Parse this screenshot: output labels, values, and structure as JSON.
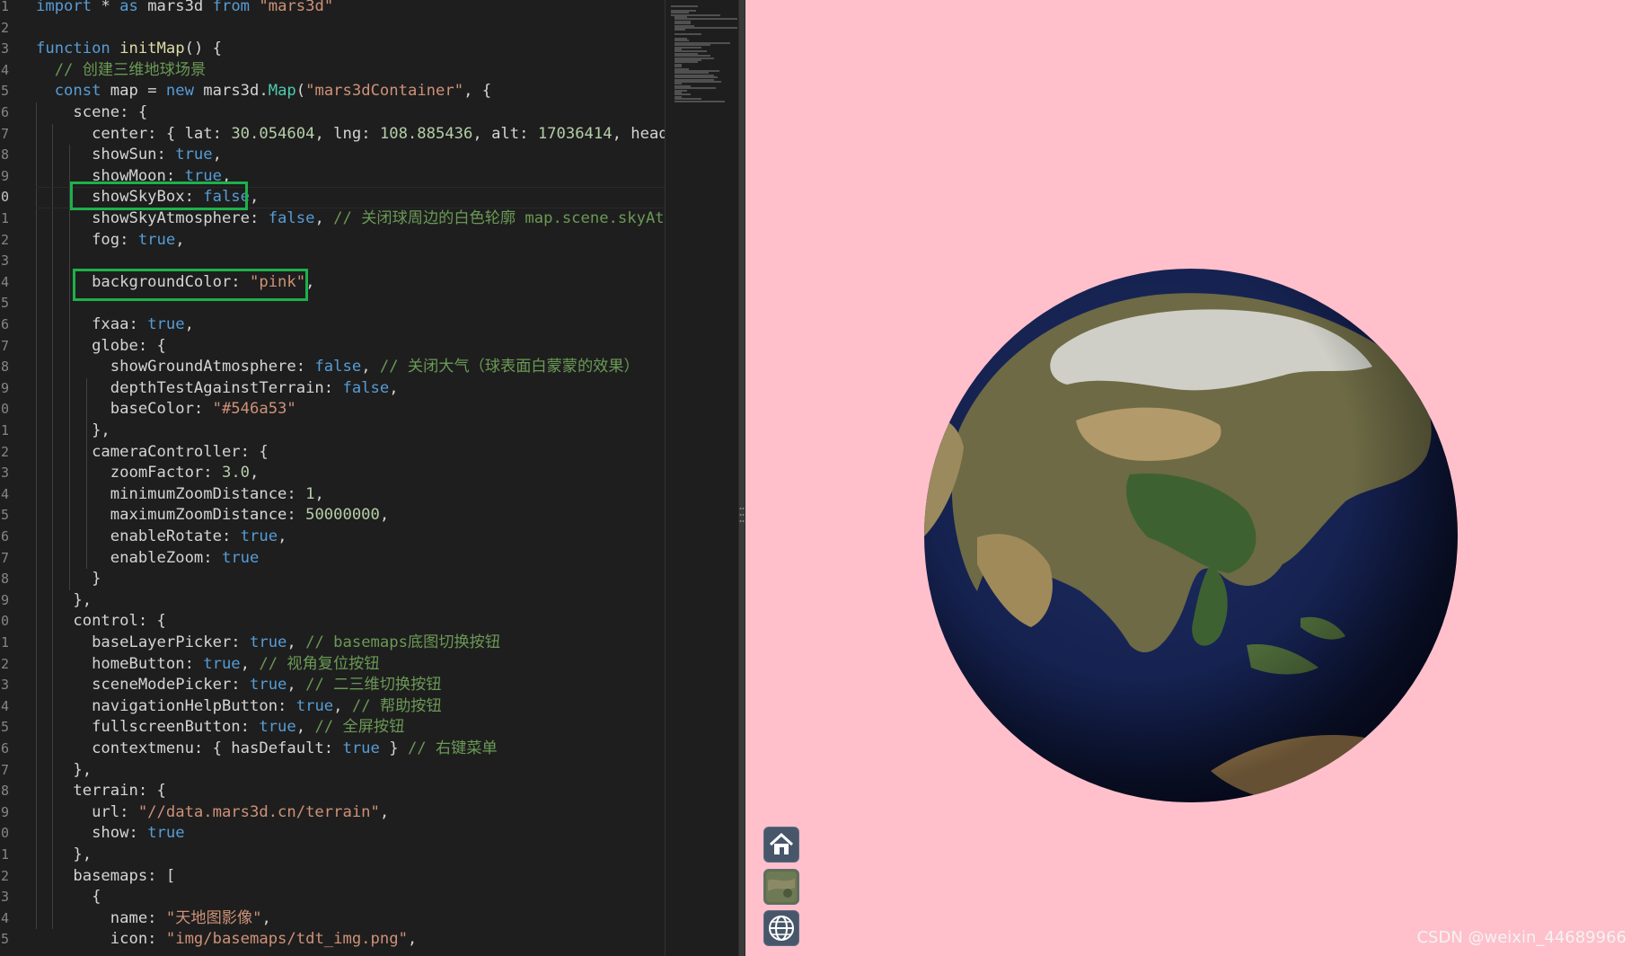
{
  "editor": {
    "lines": [
      {
        "n": "1",
        "tokens": [
          [
            "k",
            "import"
          ],
          [
            "x",
            " * "
          ],
          [
            "k",
            "as"
          ],
          [
            "x",
            " mars3d "
          ],
          [
            "k",
            "from"
          ],
          [
            "x",
            " "
          ],
          [
            "s",
            "\"mars3d\""
          ]
        ]
      },
      {
        "n": "2",
        "tokens": []
      },
      {
        "n": "3",
        "tokens": [
          [
            "k",
            "function"
          ],
          [
            "x",
            " "
          ],
          [
            "f",
            "initMap"
          ],
          [
            "x",
            "() {"
          ]
        ]
      },
      {
        "n": "4",
        "tokens": [
          [
            "x",
            "  "
          ],
          [
            "c",
            "// 创建三维地球场景"
          ]
        ]
      },
      {
        "n": "5",
        "tokens": [
          [
            "x",
            "  "
          ],
          [
            "k",
            "const"
          ],
          [
            "x",
            " map = "
          ],
          [
            "k",
            "new"
          ],
          [
            "x",
            " mars3d."
          ],
          [
            "t",
            "Map"
          ],
          [
            "x",
            "("
          ],
          [
            "s",
            "\"mars3dContainer\""
          ],
          [
            "x",
            ", {"
          ]
        ]
      },
      {
        "n": "6",
        "tokens": [
          [
            "x",
            "    scene: {"
          ]
        ]
      },
      {
        "n": "7",
        "tokens": [
          [
            "x",
            "      center: { lat: "
          ],
          [
            "n",
            "30.054604"
          ],
          [
            "x",
            ", lng: "
          ],
          [
            "n",
            "108.885436"
          ],
          [
            "x",
            ", alt: "
          ],
          [
            "n",
            "17036414"
          ],
          [
            "x",
            ", heading:"
          ]
        ]
      },
      {
        "n": "8",
        "tokens": [
          [
            "x",
            "      showSun: "
          ],
          [
            "k",
            "true"
          ],
          [
            "x",
            ","
          ]
        ]
      },
      {
        "n": "9",
        "tokens": [
          [
            "x",
            "      showMoon: "
          ],
          [
            "k",
            "true"
          ],
          [
            "x",
            ","
          ]
        ]
      },
      {
        "n": "0",
        "tokens": [
          [
            "x",
            "      showSkyBox: "
          ],
          [
            "k",
            "false"
          ],
          [
            "x",
            ","
          ]
        ]
      },
      {
        "n": "1",
        "tokens": [
          [
            "x",
            "      showSkyAtmosphere: "
          ],
          [
            "k",
            "false"
          ],
          [
            "x",
            ", "
          ],
          [
            "c",
            "// 关闭球周边的白色轮廓 map.scene.skyAtmos"
          ]
        ]
      },
      {
        "n": "2",
        "tokens": [
          [
            "x",
            "      fog: "
          ],
          [
            "k",
            "true"
          ],
          [
            "x",
            ","
          ]
        ]
      },
      {
        "n": "3",
        "tokens": []
      },
      {
        "n": "4",
        "tokens": [
          [
            "x",
            "      backgroundColor: "
          ],
          [
            "s",
            "\"pink\""
          ],
          [
            "x",
            ","
          ]
        ]
      },
      {
        "n": "5",
        "tokens": []
      },
      {
        "n": "6",
        "tokens": [
          [
            "x",
            "      fxaa: "
          ],
          [
            "k",
            "true"
          ],
          [
            "x",
            ","
          ]
        ]
      },
      {
        "n": "7",
        "tokens": [
          [
            "x",
            "      globe: {"
          ]
        ]
      },
      {
        "n": "8",
        "tokens": [
          [
            "x",
            "        showGroundAtmosphere: "
          ],
          [
            "k",
            "false"
          ],
          [
            "x",
            ", "
          ],
          [
            "c",
            "// 关闭大气（球表面白蒙蒙的效果）"
          ]
        ]
      },
      {
        "n": "9",
        "tokens": [
          [
            "x",
            "        depthTestAgainstTerrain: "
          ],
          [
            "k",
            "false"
          ],
          [
            "x",
            ","
          ]
        ]
      },
      {
        "n": "0",
        "tokens": [
          [
            "x",
            "        baseColor: "
          ],
          [
            "s",
            "\"#546a53\""
          ]
        ]
      },
      {
        "n": "1",
        "tokens": [
          [
            "x",
            "      },"
          ]
        ]
      },
      {
        "n": "2",
        "tokens": [
          [
            "x",
            "      cameraController: {"
          ]
        ]
      },
      {
        "n": "3",
        "tokens": [
          [
            "x",
            "        zoomFactor: "
          ],
          [
            "n",
            "3.0"
          ],
          [
            "x",
            ","
          ]
        ]
      },
      {
        "n": "4",
        "tokens": [
          [
            "x",
            "        minimumZoomDistance: "
          ],
          [
            "n",
            "1"
          ],
          [
            "x",
            ","
          ]
        ]
      },
      {
        "n": "5",
        "tokens": [
          [
            "x",
            "        maximumZoomDistance: "
          ],
          [
            "n",
            "50000000"
          ],
          [
            "x",
            ","
          ]
        ]
      },
      {
        "n": "6",
        "tokens": [
          [
            "x",
            "        enableRotate: "
          ],
          [
            "k",
            "true"
          ],
          [
            "x",
            ","
          ]
        ]
      },
      {
        "n": "7",
        "tokens": [
          [
            "x",
            "        enableZoom: "
          ],
          [
            "k",
            "true"
          ]
        ]
      },
      {
        "n": "8",
        "tokens": [
          [
            "x",
            "      }"
          ]
        ]
      },
      {
        "n": "9",
        "tokens": [
          [
            "x",
            "    },"
          ]
        ]
      },
      {
        "n": "0",
        "tokens": [
          [
            "x",
            "    control: {"
          ]
        ]
      },
      {
        "n": "1",
        "tokens": [
          [
            "x",
            "      baseLayerPicker: "
          ],
          [
            "k",
            "true"
          ],
          [
            "x",
            ", "
          ],
          [
            "c",
            "// basemaps底图切换按钮"
          ]
        ]
      },
      {
        "n": "2",
        "tokens": [
          [
            "x",
            "      homeButton: "
          ],
          [
            "k",
            "true"
          ],
          [
            "x",
            ", "
          ],
          [
            "c",
            "// 视角复位按钮"
          ]
        ]
      },
      {
        "n": "3",
        "tokens": [
          [
            "x",
            "      sceneModePicker: "
          ],
          [
            "k",
            "true"
          ],
          [
            "x",
            ", "
          ],
          [
            "c",
            "// 二三维切换按钮"
          ]
        ]
      },
      {
        "n": "4",
        "tokens": [
          [
            "x",
            "      navigationHelpButton: "
          ],
          [
            "k",
            "true"
          ],
          [
            "x",
            ", "
          ],
          [
            "c",
            "// 帮助按钮"
          ]
        ]
      },
      {
        "n": "5",
        "tokens": [
          [
            "x",
            "      fullscreenButton: "
          ],
          [
            "k",
            "true"
          ],
          [
            "x",
            ", "
          ],
          [
            "c",
            "// 全屏按钮"
          ]
        ]
      },
      {
        "n": "6",
        "tokens": [
          [
            "x",
            "      contextmenu: { hasDefault: "
          ],
          [
            "k",
            "true"
          ],
          [
            "x",
            " } "
          ],
          [
            "c",
            "// 右键菜单"
          ]
        ]
      },
      {
        "n": "7",
        "tokens": [
          [
            "x",
            "    },"
          ]
        ]
      },
      {
        "n": "8",
        "tokens": [
          [
            "x",
            "    terrain: {"
          ]
        ]
      },
      {
        "n": "9",
        "tokens": [
          [
            "x",
            "      url: "
          ],
          [
            "s",
            "\"//data.mars3d.cn/terrain\""
          ],
          [
            "x",
            ","
          ]
        ]
      },
      {
        "n": "0",
        "tokens": [
          [
            "x",
            "      show: "
          ],
          [
            "k",
            "true"
          ]
        ]
      },
      {
        "n": "1",
        "tokens": [
          [
            "x",
            "    },"
          ]
        ]
      },
      {
        "n": "2",
        "tokens": [
          [
            "x",
            "    basemaps: ["
          ]
        ]
      },
      {
        "n": "3",
        "tokens": [
          [
            "x",
            "      {"
          ]
        ]
      },
      {
        "n": "4",
        "tokens": [
          [
            "x",
            "        name: "
          ],
          [
            "s",
            "\"天地图影像\""
          ],
          [
            "x",
            ","
          ]
        ]
      },
      {
        "n": "5",
        "tokens": [
          [
            "x",
            "        icon: "
          ],
          [
            "s",
            "\"img/basemaps/tdt_img.png\""
          ],
          [
            "x",
            ","
          ]
        ]
      }
    ]
  },
  "viewer": {
    "background_color": "#ffc0cb",
    "toolbar": [
      {
        "name": "home-button",
        "icon": "home-icon"
      },
      {
        "name": "basemap-picker-button",
        "icon": "satellite-thumbnail-icon"
      },
      {
        "name": "scene-mode-button",
        "icon": "globe-icon"
      }
    ],
    "watermark": "CSDN @weixin_44689966"
  },
  "colors": {
    "keyword": "#569cd6",
    "string": "#ce9178",
    "comment": "#6a9955",
    "number": "#b5cea8",
    "highlight": "#1db14b"
  }
}
